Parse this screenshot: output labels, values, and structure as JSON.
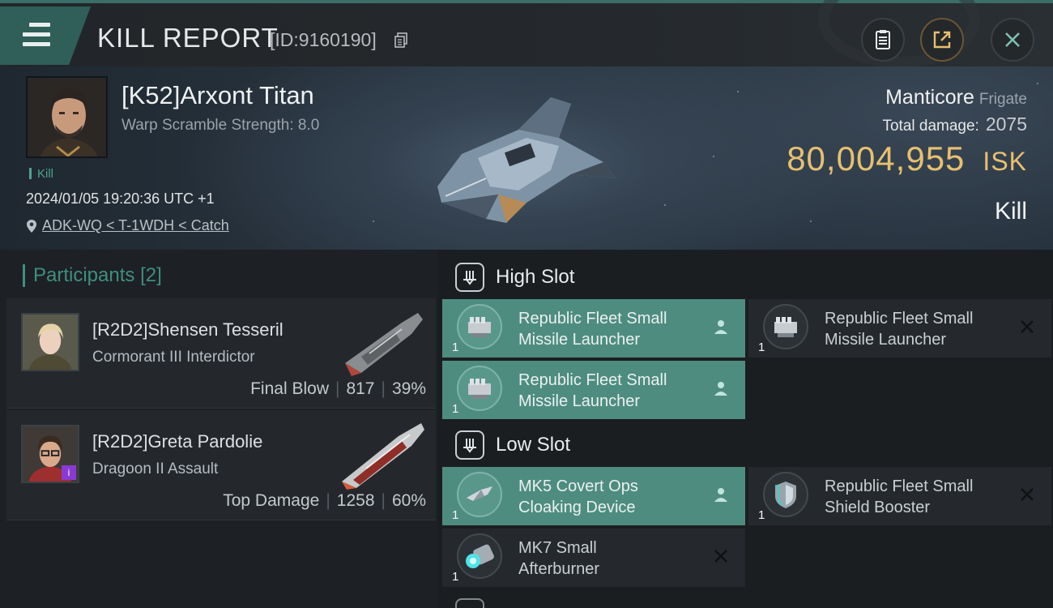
{
  "header": {
    "title": "KILL REPORT",
    "report_id": "[ID:9160190]"
  },
  "victim": {
    "name": "[K52]Arxont Titan",
    "warp_scramble": "Warp Scramble Strength: 8.0",
    "kill_tag": "Kill",
    "timestamp": "2024/01/05 19:20:36 UTC +1",
    "location": "ADK-WQ < T-1WDH < Catch",
    "ship_name": "Manticore",
    "ship_class": "Frigate",
    "total_damage_label": "Total damage:",
    "total_damage": "2075",
    "isk_value": "80,004,955",
    "isk_unit": "ISK",
    "result": "Kill"
  },
  "participants": {
    "title": "Participants",
    "count": "[2]",
    "list": [
      {
        "name": "[R2D2]Shensen Tesseril",
        "ship": "Cormorant III Interdictor",
        "role": "Final Blow",
        "damage": "817",
        "percent": "39%"
      },
      {
        "name": "[R2D2]Greta Pardolie",
        "ship": "Dragoon II Assault",
        "role": "Top Damage",
        "damage": "1258",
        "percent": "60%"
      }
    ]
  },
  "fitting": {
    "high_slot": {
      "label": "High Slot",
      "modules": [
        {
          "line1": "Republic Fleet Small",
          "line2": "Missile Launcher",
          "qty": "1",
          "state": "active"
        },
        {
          "line1": "Republic Fleet Small",
          "line2": "Missile Launcher",
          "qty": "1",
          "state": "destroyed"
        },
        {
          "line1": "Republic Fleet Small",
          "line2": "Missile Launcher",
          "qty": "1",
          "state": "active"
        }
      ]
    },
    "low_slot": {
      "label": "Low Slot",
      "modules": [
        {
          "line1": "MK5 Covert Ops",
          "line2": "Cloaking Device",
          "qty": "1",
          "state": "active"
        },
        {
          "line1": "Republic Fleet Small",
          "line2": "Shield Booster",
          "qty": "1",
          "state": "destroyed"
        },
        {
          "line1": "MK7 Small",
          "line2": "Afterburner",
          "qty": "1",
          "state": "destroyed"
        }
      ]
    }
  },
  "colors": {
    "accent": "#4f8c80",
    "isk": "#e7c06f",
    "participants_title": "#3f8f7f"
  },
  "icons": [
    "menu-icon",
    "copy-icon",
    "clipboard-icon",
    "share-icon",
    "close-icon",
    "location-pin-icon",
    "high-slot-icon",
    "low-slot-icon",
    "pilot-icon",
    "destroyed-x-icon"
  ]
}
